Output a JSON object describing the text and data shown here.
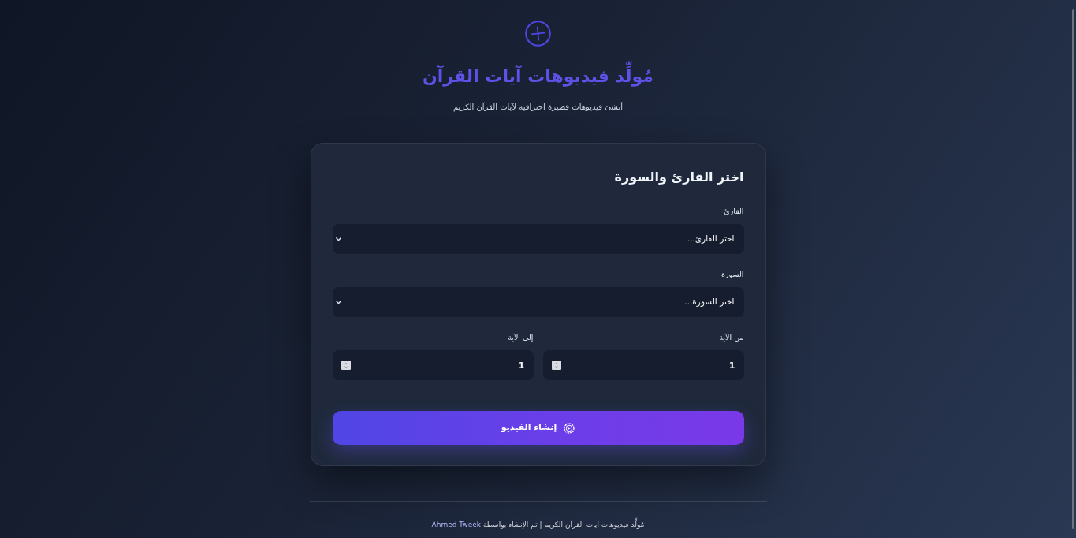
{
  "header": {
    "title": "مُولِّد فيديوهات آيات القرآن",
    "subtitle": "أنشئ فيديوهات قصيرة احترافية لآيات القرآن الكريم"
  },
  "form": {
    "title": "اختر القارئ والسورة",
    "fields": [
      {
        "kind": "select",
        "label": "القارئ",
        "value": "اختر القارئ..."
      },
      {
        "kind": "select",
        "label": "السورة",
        "value": "اختر السورة..."
      },
      {
        "kind": "number",
        "label": "من الآية",
        "value": "1"
      },
      {
        "kind": "number",
        "label": "إلى الآية",
        "value": "1"
      }
    ],
    "submit": {
      "label": "إنشاء الفيديو"
    }
  },
  "footer": {
    "text": "مُولِّد فيديوهات آيات القرآن الكريم | تم الإنشاء بواسطة",
    "link": "Ahmed Tweek"
  }
}
